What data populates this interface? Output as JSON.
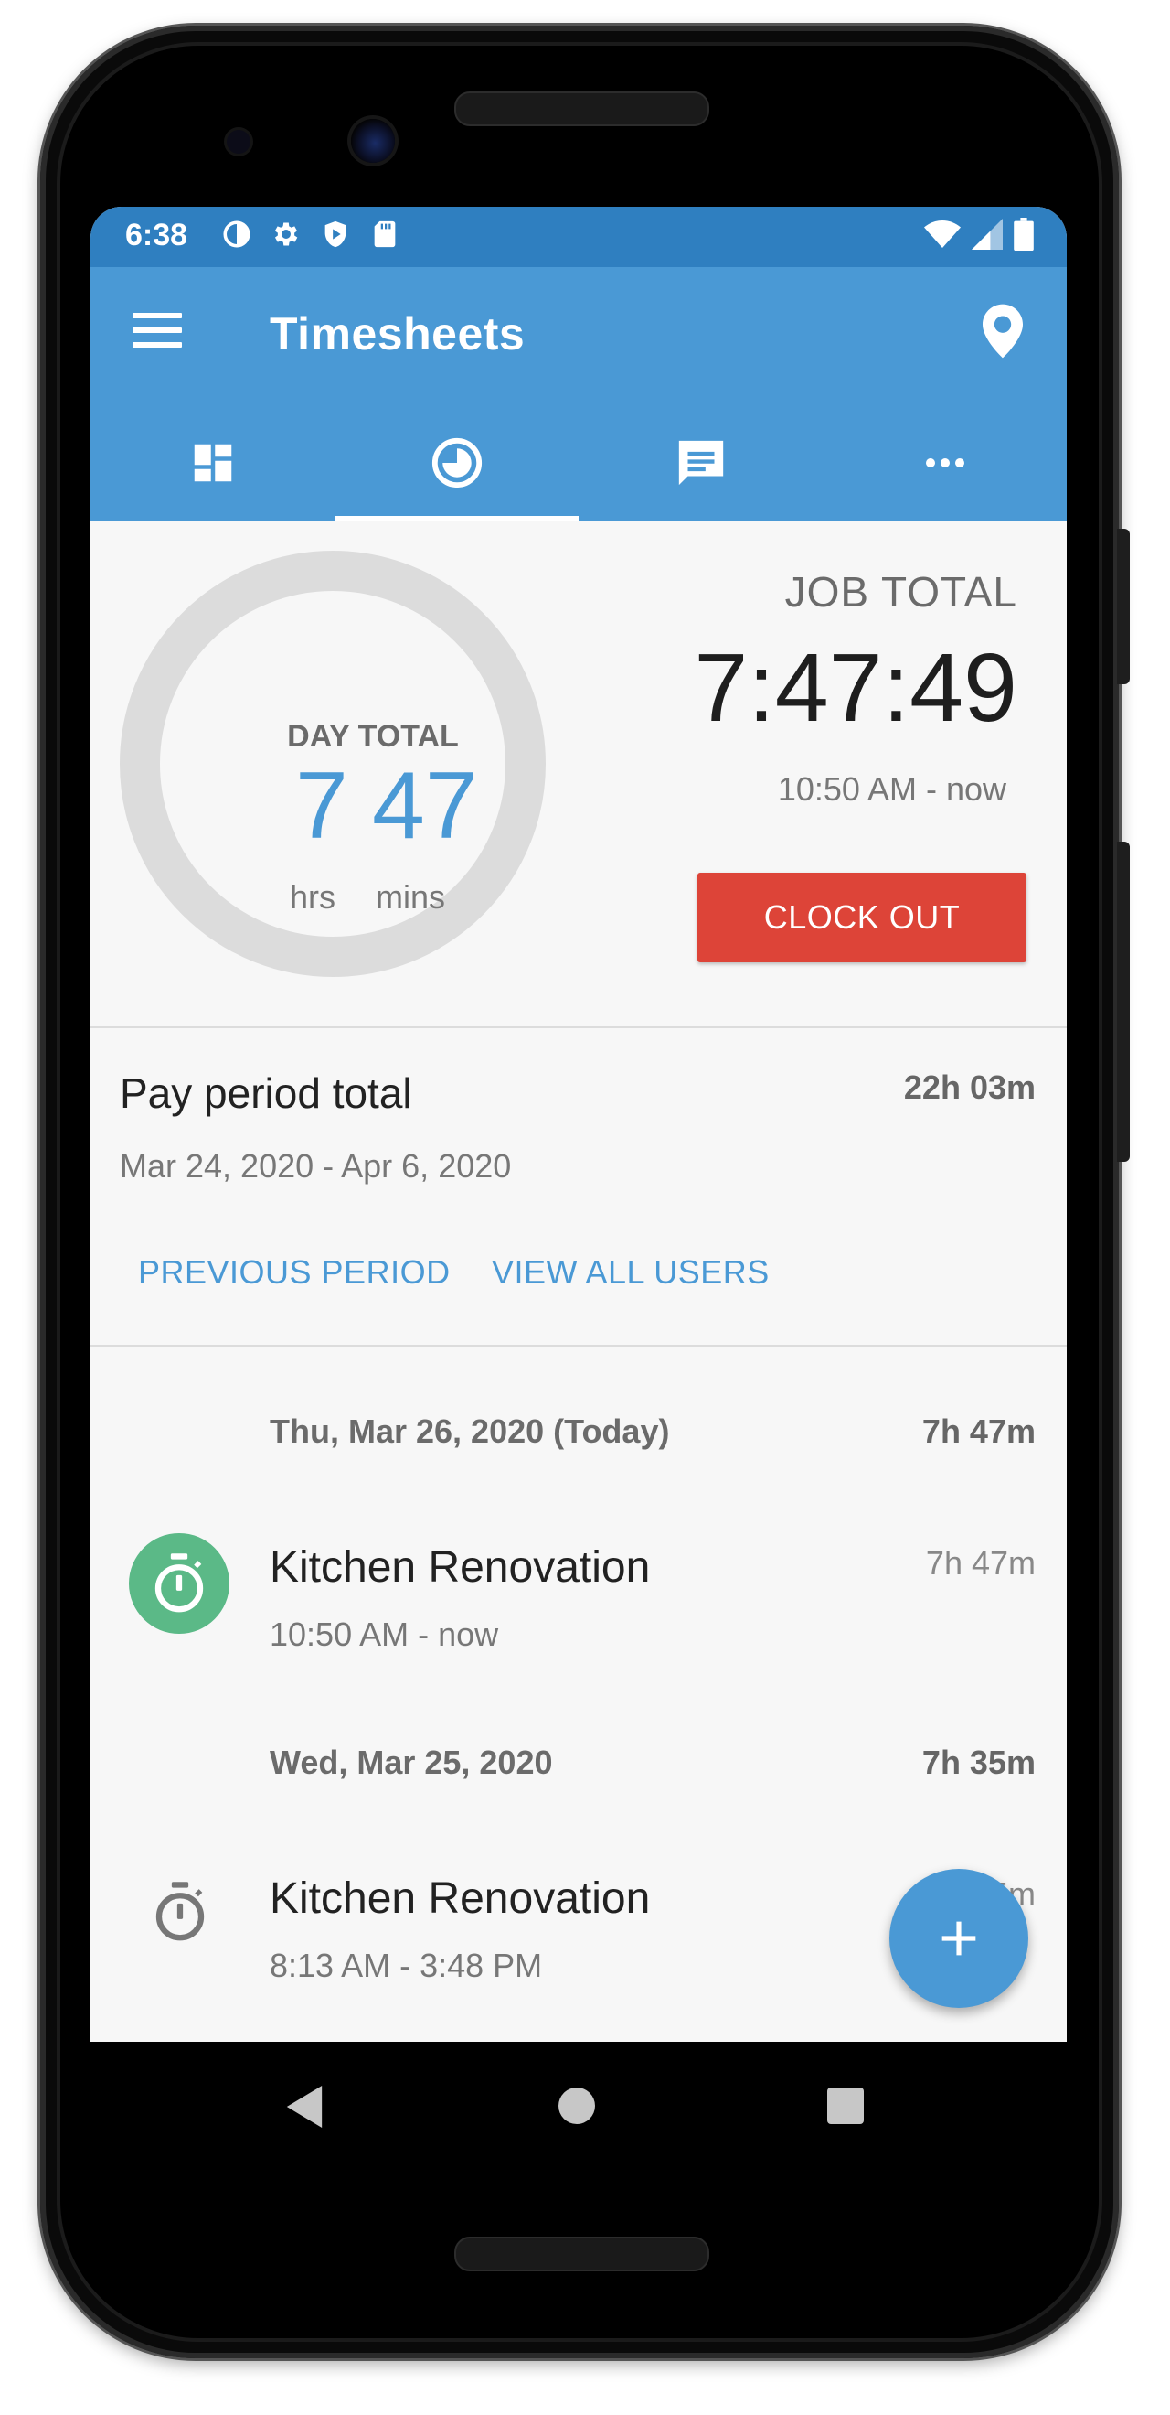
{
  "status_bar": {
    "time": "6:38"
  },
  "app_bar": {
    "title": "Timesheets"
  },
  "icons": {
    "menu": "menu-icon",
    "location": "location-pin-icon",
    "tab_dashboard": "dashboard-icon",
    "tab_timeclock": "clock-icon",
    "tab_messages": "chat-icon",
    "tab_more": "more-horizontal-icon",
    "entry_timer": "stopwatch-icon",
    "fab": "plus-icon"
  },
  "colors": {
    "app_bar": "#4a99d5",
    "status_bar": "#2f7fc0",
    "clock_out": "#dd4438",
    "active_timer": "#5bb987"
  },
  "day_total": {
    "label": "DAY TOTAL",
    "hours": "7",
    "minutes": "47",
    "hours_unit": "hrs",
    "minutes_unit": "mins"
  },
  "job_total": {
    "label": "JOB TOTAL",
    "time": "7:47:49",
    "range": "10:50 AM - now",
    "clock_out_label": "CLOCK OUT"
  },
  "pay_period": {
    "title": "Pay period total",
    "total": "22h 03m",
    "range": "Mar 24, 2020 - Apr 6, 2020",
    "previous_label": "PREVIOUS PERIOD",
    "view_all_label": "VIEW ALL USERS"
  },
  "days": [
    {
      "header": "Thu, Mar 26, 2020 (Today)",
      "total": "7h 47m",
      "entries": [
        {
          "title": "Kitchen Renovation",
          "range": "10:50 AM - now",
          "duration": "7h 47m"
        }
      ]
    },
    {
      "header": "Wed, Mar 25, 2020",
      "total": "7h 35m",
      "entries": [
        {
          "title": "Kitchen Renovation",
          "range": "8:13 AM - 3:48 PM",
          "duration": "7h 35m"
        }
      ]
    }
  ]
}
